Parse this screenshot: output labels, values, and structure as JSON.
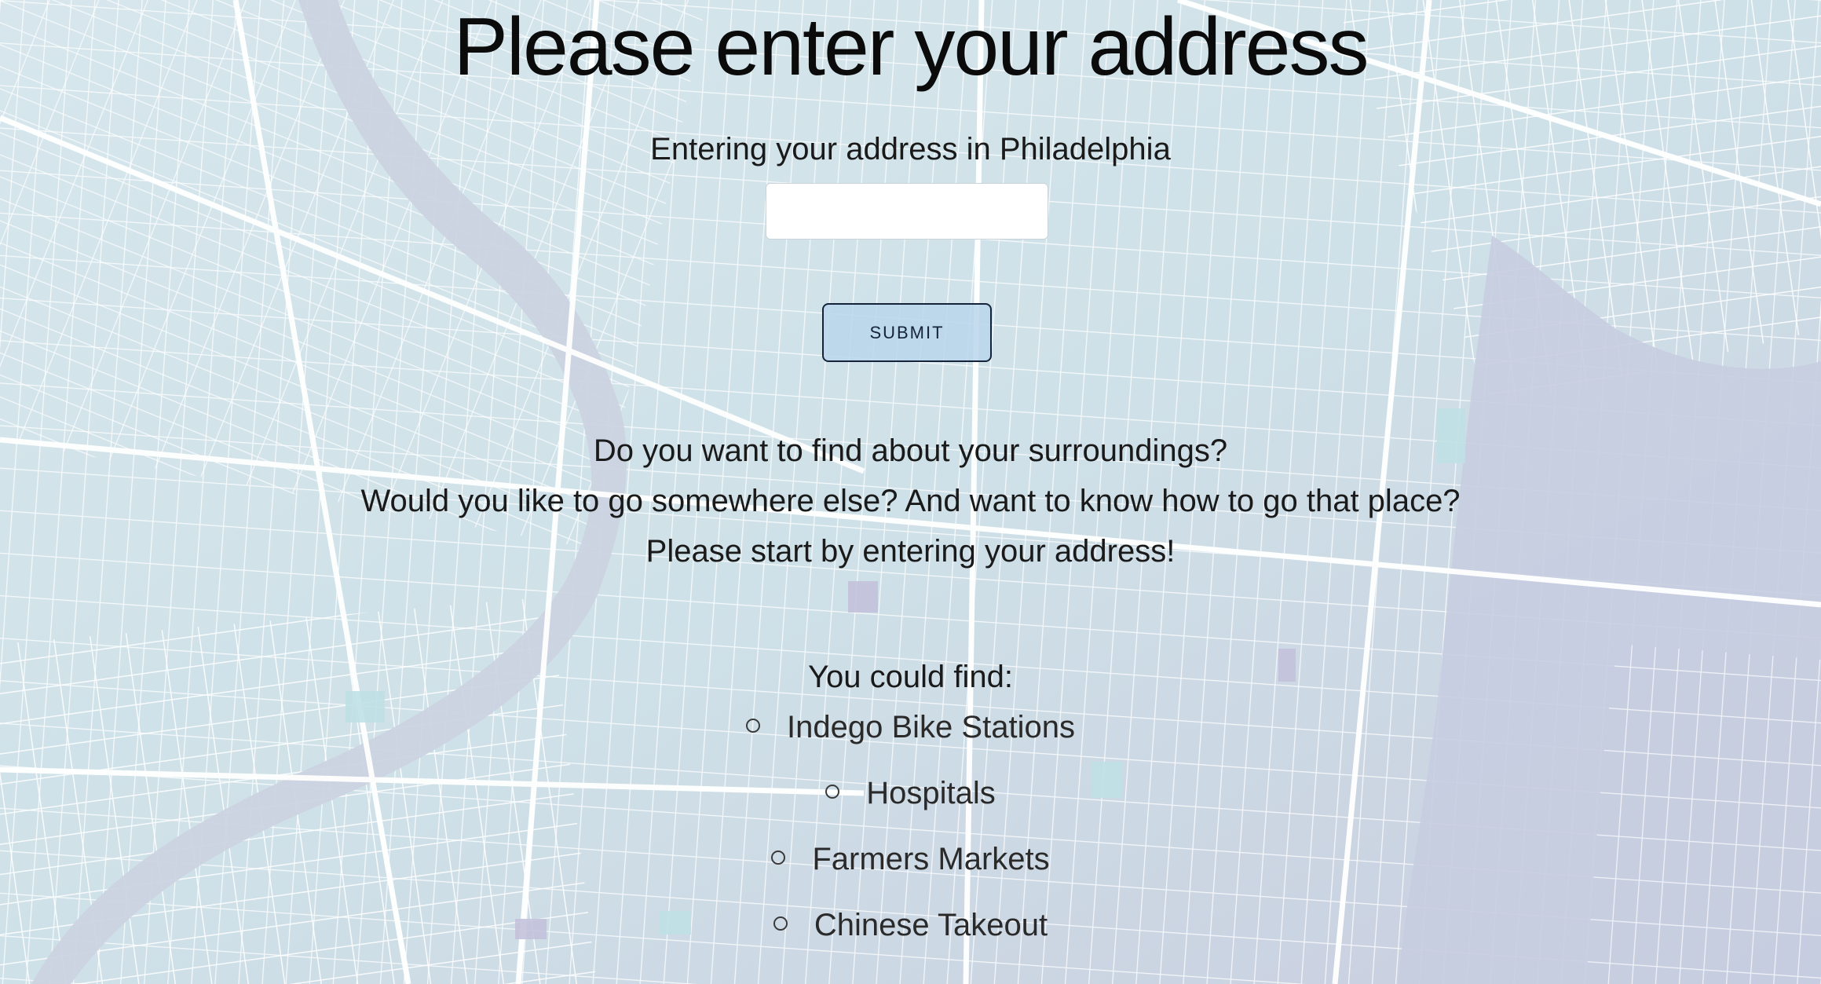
{
  "page": {
    "title": "Please enter your address"
  },
  "address_form": {
    "label": "Entering your address in Philadelphia",
    "input_value": "",
    "input_placeholder": "",
    "submit_label": "SUBMIT"
  },
  "intro": {
    "lines": [
      "Do you want to find about your surroundings?",
      "Would you like to go somewhere else? And want to know how to go that place?",
      "Please start by entering your address!"
    ]
  },
  "find": {
    "heading": "You could find:",
    "items": [
      "Indego Bike Stations",
      "Hospitals",
      "Farmers Markets",
      "Chinese Takeout"
    ]
  },
  "colors": {
    "map_background": "#cfe0e7",
    "map_streets": "#ffffff",
    "map_water": "#bdc8dc",
    "map_parks": "#c3dde4",
    "submit_bg": "#bad6eb",
    "submit_border": "#14233a",
    "text": "#111111"
  }
}
